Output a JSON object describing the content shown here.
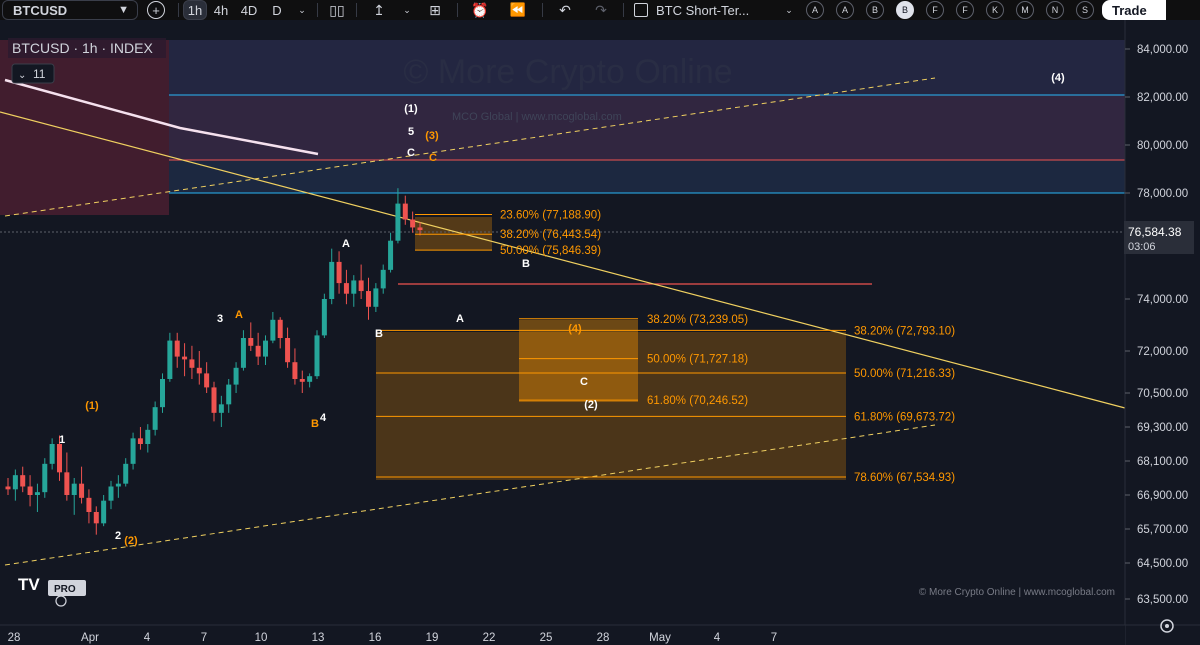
{
  "toolbar": {
    "symbol": "BTCUSD",
    "intervals": [
      "1h",
      "4h",
      "4D",
      "D"
    ],
    "layout_name": "BTC Short-Ter...",
    "alerts": [
      "A",
      "A",
      "B",
      "B",
      "F",
      "F",
      "K",
      "M",
      "N",
      "S"
    ],
    "active_alert_index": 3,
    "trade_label": "Trade"
  },
  "legend": {
    "title": "BTCUSD · 1h · INDEX",
    "indicator_count": "11"
  },
  "watermark": "© More Crypto Online",
  "inner_watermark": "MCO Global   |   www.mcoglobal.com",
  "footer_credit": "© More Crypto Online   |   www.mcoglobal.com",
  "pro_badge": "PRO",
  "price_box": {
    "price": "76,584.38",
    "countdown": "03:06"
  },
  "colors": {
    "background": "#131722",
    "bull": "#26a69a",
    "bear": "#ef5350",
    "fib": "#ff9800",
    "cyan": "#29b6f6",
    "trend": "#f0d060"
  },
  "chart_data": {
    "type": "candlestick",
    "y_ticks": [
      "84,000.00",
      "82,000.00",
      "80,000.00",
      "78,000.00",
      "74,000.00",
      "72,000.00",
      "70,500.00",
      "69,300.00",
      "68,100.00",
      "66,900.00",
      "65,700.00",
      "64,500.00",
      "63,500.00"
    ],
    "y_tick_values": [
      84000,
      82000,
      80000,
      78000,
      74000,
      72000,
      70500,
      69300,
      68100,
      66900,
      65700,
      64500,
      63500
    ],
    "x_ticks": [
      "28",
      "Apr",
      "4",
      "7",
      "10",
      "13",
      "16",
      "19",
      "22",
      "25",
      "28",
      "May",
      "4",
      "7"
    ],
    "x_tick_values": [
      -4,
      0,
      3,
      6,
      9,
      12,
      15,
      18,
      21,
      24,
      27,
      30,
      33,
      36
    ],
    "candles_ohlc": [
      [
        67200,
        67500,
        66900,
        67100
      ],
      [
        67100,
        67800,
        66700,
        67600
      ],
      [
        67600,
        67900,
        67000,
        67200
      ],
      [
        67200,
        67600,
        66500,
        66900
      ],
      [
        66900,
        67300,
        66300,
        67000
      ],
      [
        67000,
        68200,
        66800,
        68000
      ],
      [
        68000,
        68900,
        67800,
        68700
      ],
      [
        68700,
        69000,
        67400,
        67700
      ],
      [
        67700,
        68400,
        66700,
        66900
      ],
      [
        66900,
        67500,
        66200,
        67300
      ],
      [
        67300,
        67900,
        66600,
        66800
      ],
      [
        66800,
        67100,
        65900,
        66300
      ],
      [
        66300,
        66500,
        65500,
        65900
      ],
      [
        65900,
        66900,
        65800,
        66700
      ],
      [
        66700,
        67400,
        66400,
        67200
      ],
      [
        67200,
        67600,
        66800,
        67300
      ],
      [
        67300,
        68200,
        67200,
        68000
      ],
      [
        68000,
        69100,
        67800,
        68900
      ],
      [
        68900,
        69300,
        68500,
        68700
      ],
      [
        68700,
        69400,
        68400,
        69200
      ],
      [
        69200,
        70200,
        69000,
        70000
      ],
      [
        70000,
        71200,
        69800,
        71000
      ],
      [
        71000,
        72700,
        70900,
        72400
      ],
      [
        72400,
        72700,
        71400,
        71800
      ],
      [
        71800,
        72300,
        71100,
        71700
      ],
      [
        71700,
        72200,
        71000,
        71400
      ],
      [
        71400,
        72000,
        70800,
        71200
      ],
      [
        71200,
        71600,
        70500,
        70700
      ],
      [
        70700,
        70900,
        69500,
        69800
      ],
      [
        69800,
        70400,
        69300,
        70100
      ],
      [
        70100,
        71000,
        69800,
        70800
      ],
      [
        70800,
        71600,
        70500,
        71400
      ],
      [
        71400,
        72800,
        71300,
        72500
      ],
      [
        72500,
        73100,
        72000,
        72200
      ],
      [
        72200,
        72700,
        71500,
        71800
      ],
      [
        71800,
        72600,
        71500,
        72400
      ],
      [
        72400,
        73500,
        72300,
        73200
      ],
      [
        73200,
        73300,
        72100,
        72500
      ],
      [
        72500,
        72900,
        71400,
        71600
      ],
      [
        71600,
        72100,
        70800,
        71000
      ],
      [
        71000,
        71300,
        70500,
        70900
      ],
      [
        70900,
        71200,
        70700,
        71100
      ],
      [
        71100,
        72800,
        71000,
        72600
      ],
      [
        72600,
        74200,
        72500,
        74000
      ],
      [
        74000,
        75900,
        73800,
        75400
      ],
      [
        75400,
        75800,
        74200,
        74600
      ],
      [
        74600,
        75100,
        73800,
        74200
      ],
      [
        74200,
        74900,
        73700,
        74700
      ],
      [
        74700,
        75300,
        74000,
        74300
      ],
      [
        74300,
        74800,
        73200,
        73700
      ],
      [
        73700,
        74600,
        73500,
        74400
      ],
      [
        74400,
        75300,
        74200,
        75100
      ],
      [
        75100,
        76500,
        75000,
        76200
      ],
      [
        76200,
        78200,
        76100,
        77600
      ],
      [
        77600,
        77900,
        76800,
        77000
      ],
      [
        77000,
        77300,
        76500,
        76700
      ],
      [
        76700,
        76900,
        76400,
        76600
      ]
    ],
    "fib_levels": [
      {
        "label": "23.60% (77,188.90)",
        "value": 77188.9
      },
      {
        "label": "38.20% (76,443.54)",
        "value": 76443.54
      },
      {
        "label": "50.00% (75,846.39)",
        "value": 75846.39
      },
      {
        "label": "38.20% (73,239.05)",
        "value": 73239.05
      },
      {
        "label": "50.00% (71,727.18)",
        "value": 71727.18
      },
      {
        "label": "61.80% (70,246.52)",
        "value": 70246.52
      },
      {
        "label": "38.20% (72,793.10)",
        "value": 72793.1
      },
      {
        "label": "50.00% (71,216.33)",
        "value": 71216.33
      },
      {
        "label": "61.80% (69,673.72)",
        "value": 69673.72
      },
      {
        "label": "78.60% (67,534.93)",
        "value": 67534.93
      }
    ],
    "wave_labels": [
      {
        "text": "(4)",
        "color": "#ffffff"
      },
      {
        "text": "(1)",
        "color": "#ffffff"
      },
      {
        "text": "5",
        "color": "#ffffff"
      },
      {
        "text": "(3)",
        "color": "#ff9800"
      },
      {
        "text": "C",
        "color": "#ffffff"
      },
      {
        "text": "C",
        "color": "#ff9800"
      },
      {
        "text": "A",
        "color": "#ffffff"
      },
      {
        "text": "B",
        "color": "#ffffff"
      },
      {
        "text": "3",
        "color": "#ffffff"
      },
      {
        "text": "A",
        "color": "#ff9800"
      },
      {
        "text": "A",
        "color": "#ffffff"
      },
      {
        "text": "(4)",
        "color": "#ff9800"
      },
      {
        "text": "B",
        "color": "#ffffff"
      },
      {
        "text": "C",
        "color": "#ffffff"
      },
      {
        "text": "(2)",
        "color": "#ffffff"
      },
      {
        "text": "(1)",
        "color": "#ff9800"
      },
      {
        "text": "1",
        "color": "#ffffff"
      },
      {
        "text": "4",
        "color": "#ffffff"
      },
      {
        "text": "B",
        "color": "#ff9800"
      },
      {
        "text": "2",
        "color": "#ffffff"
      },
      {
        "text": "(2)",
        "color": "#ff9800"
      }
    ]
  }
}
